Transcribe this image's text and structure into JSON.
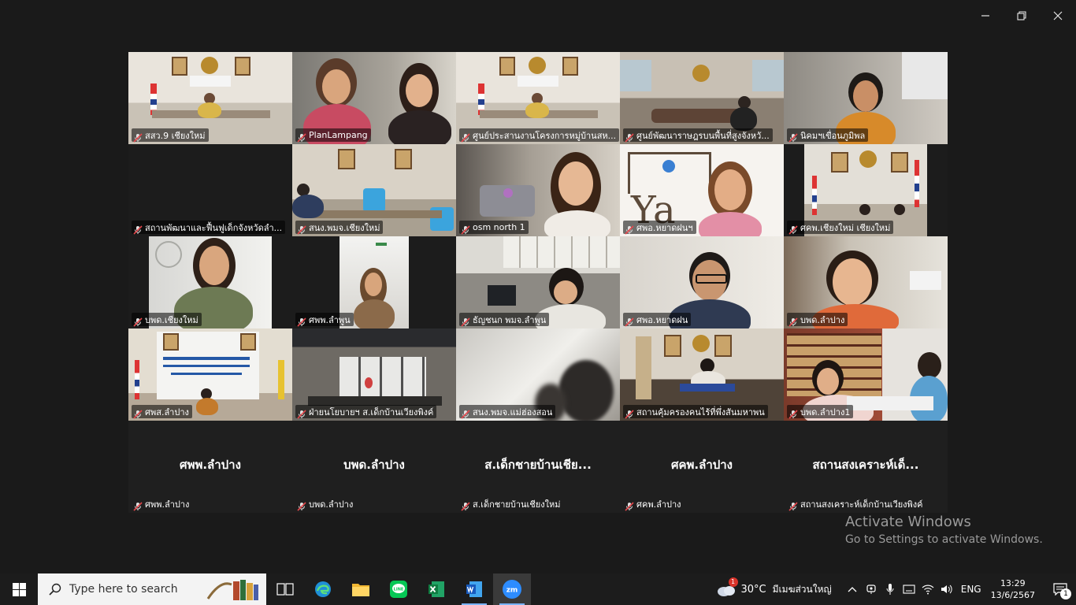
{
  "tiles": [
    {
      "name": "สสว.9 เชียงใหม่",
      "active": true,
      "scene": "room-thai"
    },
    {
      "name": "PlanLampang",
      "scene": "two-women"
    },
    {
      "name": "ศูนย์ประสานงานโครงการหมู่บ้านสห...",
      "scene": "room-thai"
    },
    {
      "name": "ศูนย์พัฒนาราษฎรบนพื้นที่สูงจังหวั...",
      "scene": "meeting"
    },
    {
      "name": "นิคมฯเขื่อนภูมิพล",
      "scene": "office-person"
    },
    {
      "name": "สถานพัฒนาและฟื้นฟูเด็กจังหวัดลำ...",
      "scene": "black"
    },
    {
      "name": "สนง.พมจ.เชียงใหม่",
      "scene": "room-blue"
    },
    {
      "name": "osm north 1",
      "scene": "woman-close"
    },
    {
      "name": "ศพอ.หยาดฝนฯ",
      "scene": "yahdfon"
    },
    {
      "name": "ศคพ.เชียงใหม่ เชียงใหม่",
      "scene": "room-flags"
    },
    {
      "name": "บพด.เชียงใหม่",
      "scene": "narrow-woman"
    },
    {
      "name": "ศพพ.ลำพูน",
      "scene": "narrow-woman2"
    },
    {
      "name": "ธัญชนก พมจ.ลำพูน",
      "scene": "office-wide"
    },
    {
      "name": "ศพอ.หยาดฝน",
      "scene": "man-glasses"
    },
    {
      "name": "บพด.ลำปาง",
      "scene": "woman-office"
    },
    {
      "name": "ศพส.ลำปาง",
      "scene": "room-banner"
    },
    {
      "name": "ฝ่ายนโยบายฯ ส.เด็กบ้านเวียงพิงค์",
      "scene": "room-window"
    },
    {
      "name": "สนง.พมจ.แม่ฮ่องสอน",
      "scene": "blur"
    },
    {
      "name": "สถานคุ้มครองคนไร้ที่พึ่งสันมหาพน",
      "scene": "meeting2"
    },
    {
      "name": "บพด.ลำปาง1",
      "scene": "library"
    },
    {
      "name": "ศพพ.ลำปาง",
      "big": "ศพพ.ลำปาง",
      "scene": "blank"
    },
    {
      "name": "บพด.ลำปาง",
      "big": "บพด.ลำปาง",
      "scene": "blank"
    },
    {
      "name": "ส.เด็กชายบ้านเชียงใหม่",
      "big": "ส.เด็กชายบ้านเชีย...",
      "scene": "blank"
    },
    {
      "name": "ศคพ.ลำปาง",
      "big": "ศคพ.ลำปาง",
      "scene": "blank"
    },
    {
      "name": "สถานสงเคราะห์เด็กบ้านเวียงพิงค์",
      "big": "สถานสงเคราะห์เด็...",
      "scene": "blank"
    }
  ],
  "watermark": {
    "line1": "Activate Windows",
    "line2": "Go to Settings to activate Windows."
  },
  "taskbar": {
    "search_placeholder": "Type here to search",
    "weather_temp": "30°C",
    "weather_cond": "มีเมฆส่วนใหญ่",
    "weather_badge": "1",
    "lang": "ENG",
    "time": "13:29",
    "date": "13/6/2567",
    "notif_count": "1"
  },
  "colors": {
    "active_border": "#2ed573",
    "taskbar": "#1c1c1c",
    "background": "#1a1a1a"
  }
}
